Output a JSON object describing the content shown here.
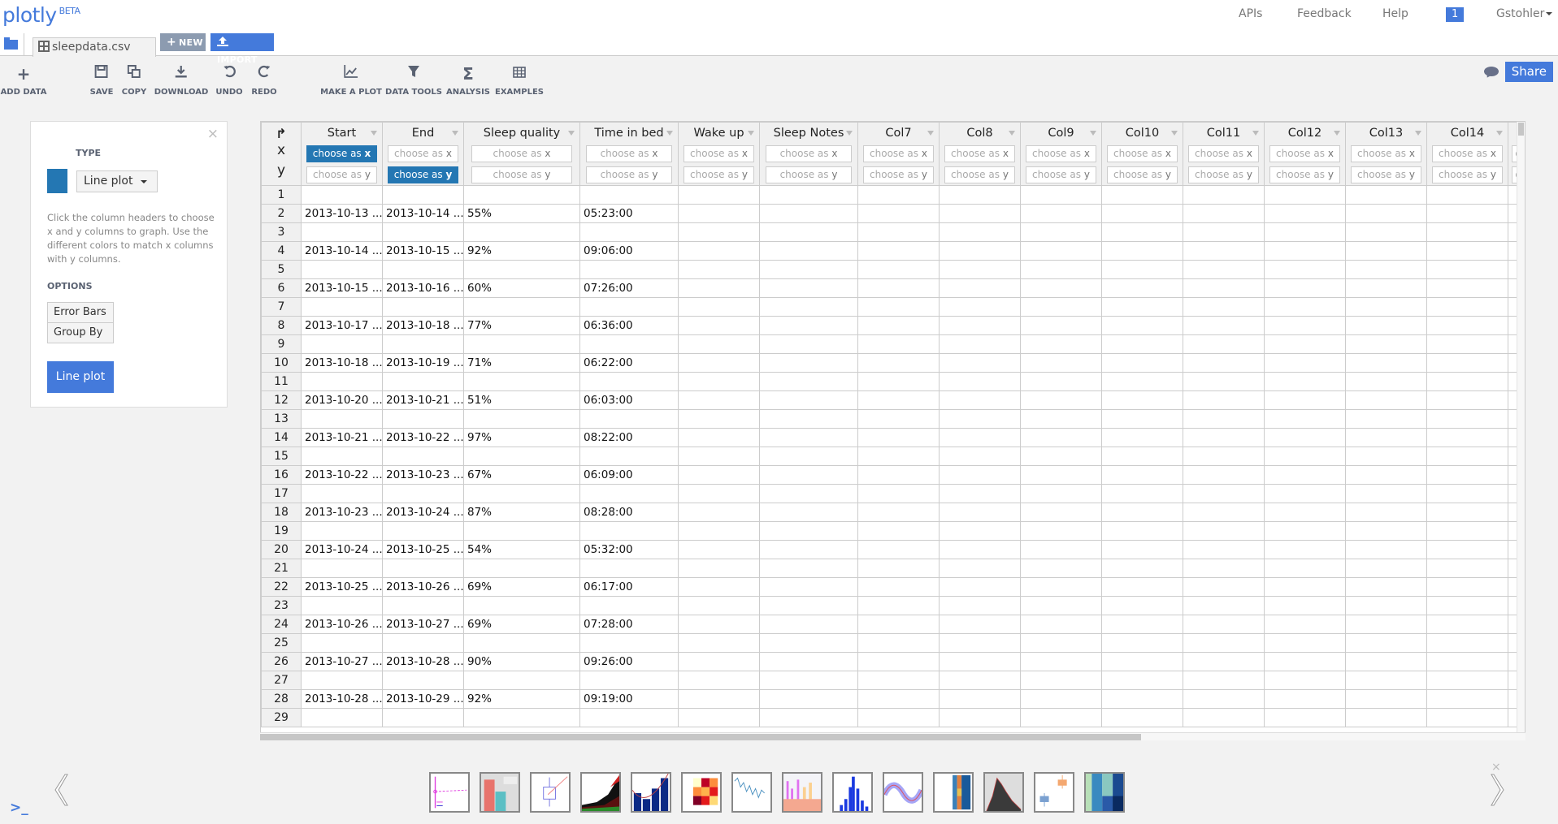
{
  "app": {
    "logo": "plotly",
    "logo_badge": "BETA"
  },
  "nav": {
    "apis": "APIs",
    "feedback": "Feedback",
    "help": "Help",
    "notifications_count": "1",
    "user": "Gstohler"
  },
  "tabs": {
    "file_name": "sleepdata.csv",
    "new_label": "NEW",
    "import_label": "IMPORT"
  },
  "toolbar": {
    "add_data": "ADD DATA",
    "save": "SAVE",
    "copy": "COPY",
    "download": "DOWNLOAD",
    "undo": "UNDO",
    "redo": "REDO",
    "make_a_plot": "MAKE A PLOT",
    "data_tools": "DATA TOOLS",
    "analysis": "ANALYSIS",
    "examples": "EXAMPLES",
    "share": "Share"
  },
  "panel": {
    "type_label": "TYPE",
    "trace_color": "#2477b3",
    "plot_type": "Line plot",
    "help_text": "Click the column headers to choose x and y columns to graph. Use the different colors to match x columns with y columns.",
    "options_label": "OPTIONS",
    "options": [
      "Error Bars",
      "Group By"
    ],
    "plot_button": "Line plot"
  },
  "grid": {
    "corner": {
      "x": "x",
      "y": "y"
    },
    "choose_x_prefix": "choose as ",
    "choose_x_suffix": "x",
    "choose_y_prefix": "choose as ",
    "choose_y_suffix": "y",
    "columns": [
      {
        "name": "Start",
        "x_selected": true,
        "y_selected": false
      },
      {
        "name": "End",
        "x_selected": false,
        "y_selected": true
      },
      {
        "name": "Sleep quality",
        "x_selected": false,
        "y_selected": false
      },
      {
        "name": "Time in bed",
        "x_selected": false,
        "y_selected": false
      },
      {
        "name": "Wake up",
        "x_selected": false,
        "y_selected": false
      },
      {
        "name": "Sleep Notes",
        "x_selected": false,
        "y_selected": false
      },
      {
        "name": "Col7",
        "x_selected": false,
        "y_selected": false
      },
      {
        "name": "Col8",
        "x_selected": false,
        "y_selected": false
      },
      {
        "name": "Col9",
        "x_selected": false,
        "y_selected": false
      },
      {
        "name": "Col10",
        "x_selected": false,
        "y_selected": false
      },
      {
        "name": "Col11",
        "x_selected": false,
        "y_selected": false
      },
      {
        "name": "Col12",
        "x_selected": false,
        "y_selected": false
      },
      {
        "name": "Col13",
        "x_selected": false,
        "y_selected": false
      },
      {
        "name": "Col14",
        "x_selected": false,
        "y_selected": false
      },
      {
        "name": "",
        "x_selected": false,
        "y_selected": false
      }
    ],
    "rows": [
      {
        "n": "1",
        "cells": [
          "",
          "",
          "",
          ""
        ]
      },
      {
        "n": "2",
        "cells": [
          "2013-10-13 ...",
          "2013-10-14 ...",
          "55%",
          "05:23:00"
        ]
      },
      {
        "n": "3",
        "cells": [
          "",
          "",
          "",
          ""
        ]
      },
      {
        "n": "4",
        "cells": [
          "2013-10-14 ...",
          "2013-10-15 ...",
          "92%",
          "09:06:00"
        ]
      },
      {
        "n": "5",
        "cells": [
          "",
          "",
          "",
          ""
        ]
      },
      {
        "n": "6",
        "cells": [
          "2013-10-15 ...",
          "2013-10-16 ...",
          "60%",
          "07:26:00"
        ]
      },
      {
        "n": "7",
        "cells": [
          "",
          "",
          "",
          ""
        ]
      },
      {
        "n": "8",
        "cells": [
          "2013-10-17 ...",
          "2013-10-18 ...",
          "77%",
          "06:36:00"
        ]
      },
      {
        "n": "9",
        "cells": [
          "",
          "",
          "",
          ""
        ]
      },
      {
        "n": "10",
        "cells": [
          "2013-10-18 ...",
          "2013-10-19 ...",
          "71%",
          "06:22:00"
        ]
      },
      {
        "n": "11",
        "cells": [
          "",
          "",
          "",
          ""
        ]
      },
      {
        "n": "12",
        "cells": [
          "2013-10-20 ...",
          "2013-10-21 ...",
          "51%",
          "06:03:00"
        ]
      },
      {
        "n": "13",
        "cells": [
          "",
          "",
          "",
          ""
        ]
      },
      {
        "n": "14",
        "cells": [
          "2013-10-21 ...",
          "2013-10-22 ...",
          "97%",
          "08:22:00"
        ]
      },
      {
        "n": "15",
        "cells": [
          "",
          "",
          "",
          ""
        ]
      },
      {
        "n": "16",
        "cells": [
          "2013-10-22 ...",
          "2013-10-23 ...",
          "67%",
          "06:09:00"
        ]
      },
      {
        "n": "17",
        "cells": [
          "",
          "",
          "",
          ""
        ]
      },
      {
        "n": "18",
        "cells": [
          "2013-10-23 ...",
          "2013-10-24 ...",
          "87%",
          "08:28:00"
        ]
      },
      {
        "n": "19",
        "cells": [
          "",
          "",
          "",
          ""
        ]
      },
      {
        "n": "20",
        "cells": [
          "2013-10-24 ...",
          "2013-10-25 ...",
          "54%",
          "05:32:00"
        ]
      },
      {
        "n": "21",
        "cells": [
          "",
          "",
          "",
          ""
        ]
      },
      {
        "n": "22",
        "cells": [
          "2013-10-25 ...",
          "2013-10-26 ...",
          "69%",
          "06:17:00"
        ]
      },
      {
        "n": "23",
        "cells": [
          "",
          "",
          "",
          ""
        ]
      },
      {
        "n": "24",
        "cells": [
          "2013-10-26 ...",
          "2013-10-27 ...",
          "69%",
          "07:28:00"
        ]
      },
      {
        "n": "25",
        "cells": [
          "",
          "",
          "",
          ""
        ]
      },
      {
        "n": "26",
        "cells": [
          "2013-10-27 ...",
          "2013-10-28 ...",
          "90%",
          "09:26:00"
        ]
      },
      {
        "n": "27",
        "cells": [
          "",
          "",
          "",
          ""
        ]
      },
      {
        "n": "28",
        "cells": [
          "2013-10-28 ...",
          "2013-10-29 ...",
          "92%",
          "09:19:00"
        ]
      },
      {
        "n": "29",
        "cells": [
          "",
          "",
          "",
          ""
        ]
      }
    ]
  },
  "examples_strip": [
    {
      "name": "error-bars-example"
    },
    {
      "name": "bar-error-example"
    },
    {
      "name": "box-scatter-example"
    },
    {
      "name": "stacked-area-example"
    },
    {
      "name": "bar-line-example"
    },
    {
      "name": "heatmap-example"
    },
    {
      "name": "timeseries-example"
    },
    {
      "name": "overlaid-histogram-example"
    },
    {
      "name": "histogram-example"
    },
    {
      "name": "sine-scatter-example"
    },
    {
      "name": "annotated-heatmap-example"
    },
    {
      "name": "density-histogram-example"
    },
    {
      "name": "box-plot-example"
    },
    {
      "name": "colormap-heatmap-example"
    }
  ]
}
